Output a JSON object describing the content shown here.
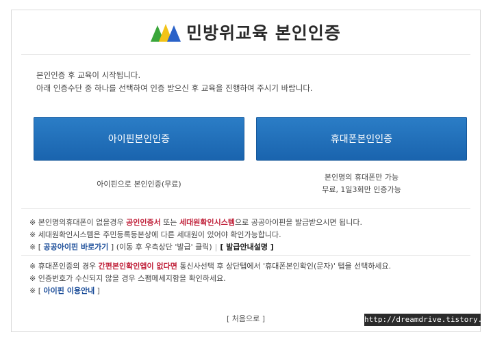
{
  "header": {
    "title": "민방위교육 본인인증"
  },
  "intro": {
    "line1": "본인인증 후 교육이 시작됩니다.",
    "line2": "아래 인증수단 중 하나를 선택하여 인증 받으신 후 교육을 진행하여 주시기 바랍니다."
  },
  "buttons": {
    "ipin_label": "아이핀본인인증",
    "phone_label": "휴대폰본인인증"
  },
  "descriptions": {
    "ipin": "아이핀으로 본인인증(무료)",
    "phone_line1": "본인명의 휴대폰만 가능",
    "phone_line2": "무료, 1일3회만 인증가능"
  },
  "notes1": {
    "line1_a": "※ 본인명의휴대폰이 없을경우 ",
    "line1_b": "공인인증서",
    "line1_c": " 또는 ",
    "line1_d": "세대원확인시스템",
    "line1_e": "으로 공공아이핀을 발급받으시면 됩니다.",
    "line2": "※ 세대원확인시스템은 주민등록등본상에 다른 세대원이 있어야 확인가능합니다.",
    "line3_prefix": "※ [ ",
    "line3_link": "공공아이핀 바로가기",
    "line3_mid": " ] (이동 후 우측상단 '발급' 클릭)",
    "line3_sep": "|",
    "line3_guide": "[ 발급안내설명 ]"
  },
  "notes2": {
    "line1_a": "※ 휴대폰인증의 경우 ",
    "line1_b": "간편본인확인앱이 없다면",
    "line1_c": " 통신사선택 후 상단탭에서 '휴대폰본인확인(문자)' 탭을 선택하세요.",
    "line2": "※ 인증번호가 수신되지 않을 경우 스팸메세지함을 확인하세요.",
    "line3_prefix": "※ [ ",
    "line3_link": "아이핀 이용안내",
    "line3_suffix": " ]"
  },
  "footer": {
    "home_link": "[ 처음으로 ]"
  },
  "watermark": {
    "text": "http://dreamdrive.tistory.com"
  },
  "colors": {
    "button_blue": "#1f6db8",
    "highlight_red": "#c0213a",
    "link_blue": "#1b4d99"
  }
}
